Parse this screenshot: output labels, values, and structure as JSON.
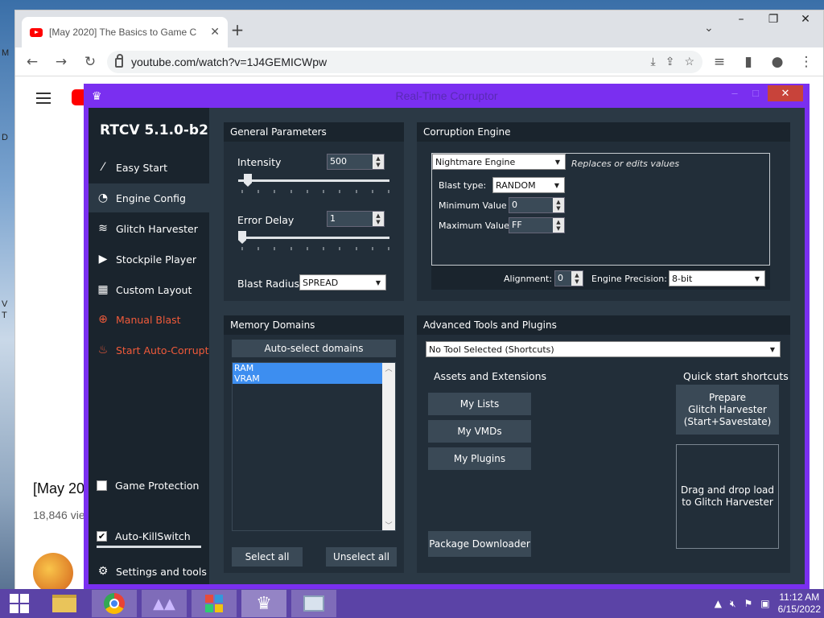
{
  "desktop": {
    "letters": [
      "M",
      "D",
      "V",
      "T"
    ]
  },
  "browser": {
    "tab_title": "[May 2020] The Basics to Game C",
    "url": "youtube.com/watch?v=1J4GEMICWpw",
    "window_controls": [
      "–",
      "❐",
      "✕"
    ]
  },
  "youtube": {
    "video_title_partial": "[May 20",
    "views_partial": "18,846 vie"
  },
  "rtc": {
    "window_title": "Real-Time Corruptor",
    "version": "RTCV 5.1.0-b2",
    "nav": [
      {
        "label": "Easy Start",
        "icon": "wand-icon"
      },
      {
        "label": "Engine Config",
        "icon": "gauge-icon"
      },
      {
        "label": "Glitch Harvester",
        "icon": "layers-icon"
      },
      {
        "label": "Stockpile Player",
        "icon": "play-icon"
      },
      {
        "label": "Custom Layout",
        "icon": "grid-icon"
      },
      {
        "label": "Manual Blast",
        "icon": "crosshair-icon"
      },
      {
        "label": "Start Auto-Corrupt",
        "icon": "flame-icon"
      }
    ],
    "game_protection": {
      "label": "Game Protection",
      "checked": false
    },
    "auto_killswitch": {
      "label": "Auto-KillSwitch",
      "checked": true
    },
    "settings": "Settings and tools",
    "general": {
      "header": "General Parameters",
      "intensity_label": "Intensity",
      "intensity_value": "500",
      "intensity_fraction": 0.04,
      "error_delay_label": "Error Delay",
      "error_delay_value": "1",
      "error_delay_fraction": 0.0,
      "blast_radius_label": "Blast Radius:",
      "blast_radius_value": "SPREAD"
    },
    "engine": {
      "header": "Corruption Engine",
      "engine_value": "Nightmare Engine",
      "engine_desc": "Replaces or edits values",
      "blast_type_label": "Blast type:",
      "blast_type_value": "RANDOM",
      "min_label": "Minimum Value",
      "min_value": "0",
      "max_label": "Maximum Value",
      "max_value": "FF",
      "alignment_label": "Alignment:",
      "alignment_value": "0",
      "precision_label": "Engine Precision:",
      "precision_value": "8-bit"
    },
    "memory": {
      "header": "Memory Domains",
      "auto_select": "Auto-select domains",
      "domains": [
        "RAM",
        "VRAM"
      ],
      "select_all": "Select all",
      "unselect_all": "Unselect all"
    },
    "advanced": {
      "header": "Advanced Tools and Plugins",
      "tool_value": "No Tool Selected (Shortcuts)",
      "assets_header": "Assets and Extensions",
      "my_lists": "My Lists",
      "my_vmds": "My VMDs",
      "my_plugins": "My Plugins",
      "package_downloader": "Package Downloader",
      "quick_header": "Quick start shortcuts",
      "prepare_line1": "Prepare",
      "prepare_line2": "Glitch Harvester",
      "prepare_line3": "(Start+Savestate)",
      "drag_line1": "Drag and drop load",
      "drag_line2": "to Glitch Harvester"
    }
  },
  "taskbar": {
    "time": "11:12 AM",
    "date": "6/15/2022"
  },
  "colors": {
    "rtc_frame": "#7a2ff0",
    "rtc_body": "#2b3945",
    "rtc_sidebar": "#1a242d",
    "manual_blast_red": "#f05a3a",
    "taskbar": "#5b43a6"
  }
}
